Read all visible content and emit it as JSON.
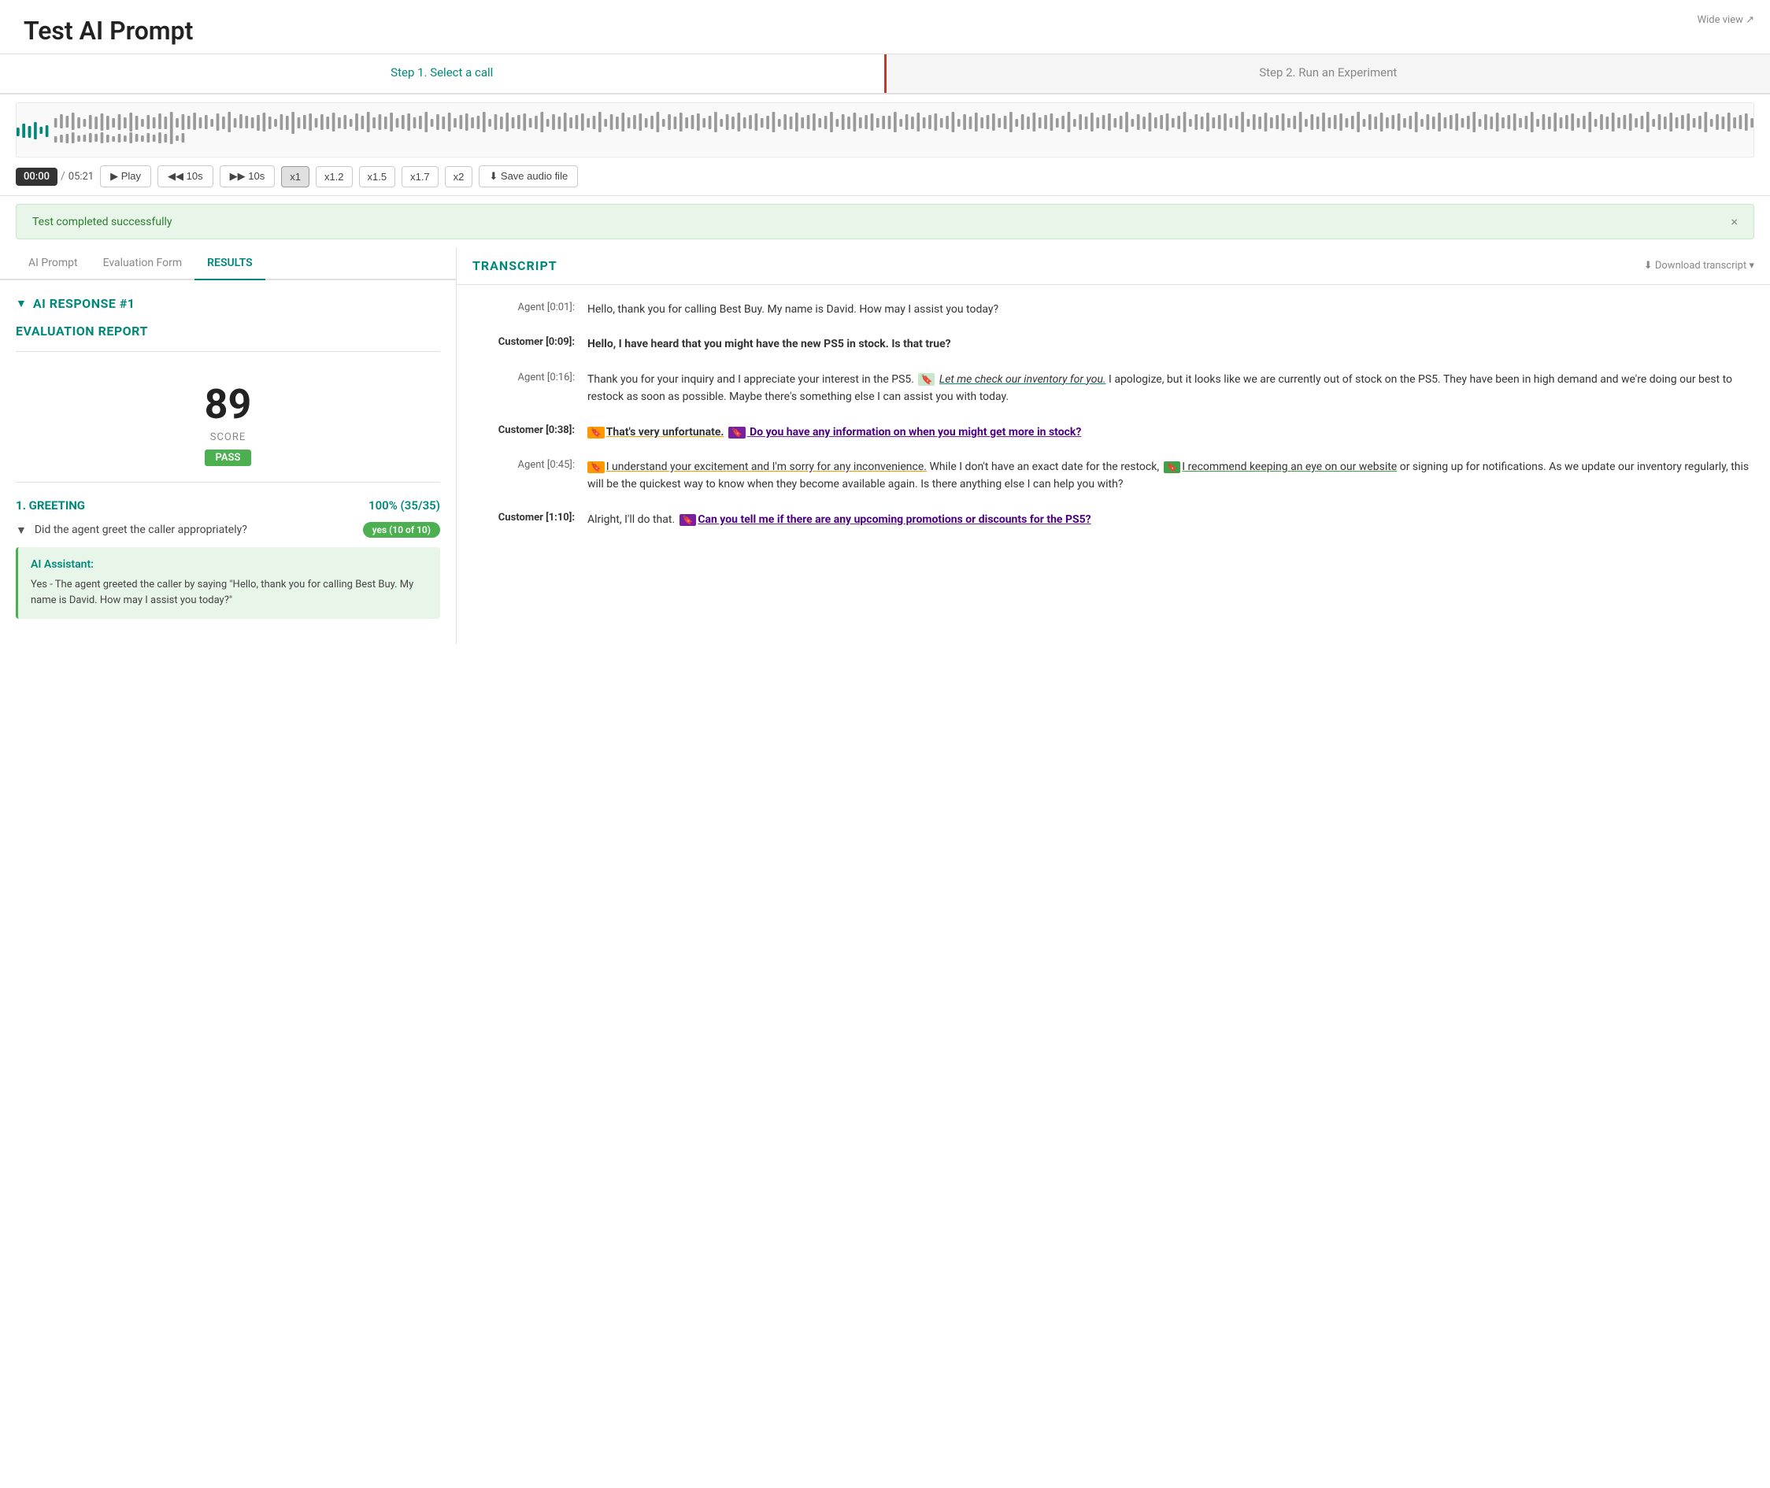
{
  "page": {
    "title": "Test AI Prompt",
    "wide_view": "Wide view ↗"
  },
  "steps": [
    {
      "id": "step1",
      "label": "Step 1. Select a call",
      "active": true
    },
    {
      "id": "step2",
      "label": "Step 2. Run an Experiment",
      "active": false
    }
  ],
  "audio": {
    "current_time": "00:00",
    "total_time": "05:21",
    "play_label": "▶ Play",
    "rewind_label": "◀◀ 10s",
    "forward_label": "▶▶ 10s",
    "speeds": [
      "x1",
      "x1.2",
      "x1.5",
      "x1.7",
      "x2"
    ],
    "active_speed": "x1",
    "save_label": "⬇ Save audio file"
  },
  "banner": {
    "text": "Test completed successfully",
    "close": "×"
  },
  "tabs": [
    {
      "id": "ai-prompt",
      "label": "AI Prompt"
    },
    {
      "id": "evaluation-form",
      "label": "Evaluation Form"
    },
    {
      "id": "results",
      "label": "RESULTS",
      "active": true
    }
  ],
  "results": {
    "ai_response_title": "AI RESPONSE #1",
    "eval_report_title": "EVALUATION REPORT",
    "score": "89",
    "score_label": "SCORE",
    "pass_label": "PASS",
    "sections": [
      {
        "id": "greeting",
        "title": "1.  GREETING",
        "score": "100% (35/35)",
        "questions": [
          {
            "text": "Did the agent greet the caller appropriately?",
            "answer": "yes (10 of 10)",
            "ai_assistant": {
              "label": "AI Assistant:",
              "text": "Yes - The agent greeted the caller by saying \"Hello, thank you for calling Best Buy. My name is David. How may I assist you today?\""
            }
          }
        ]
      }
    ]
  },
  "transcript": {
    "title": "TRANSCRIPT",
    "download_label": "⬇ Download transcript ▾",
    "entries": [
      {
        "speaker": "Agent [0:01]:",
        "is_customer": false,
        "text": "Hello, thank you for calling Best Buy. My name is David. How may I assist you today?"
      },
      {
        "speaker": "Customer [0:09]:",
        "is_customer": true,
        "text": "Hello, I have heard that you might have the new PS5 in stock. Is that true?"
      },
      {
        "speaker": "Agent [0:16]:",
        "is_customer": false,
        "text_parts": [
          {
            "type": "normal",
            "text": "Thank you for your inquiry and I appreciate your interest in the PS5. "
          },
          {
            "type": "teal-underline",
            "text": "Let me check our inventory for you."
          },
          {
            "type": "normal",
            "text": " I apologize, but it looks like we are currently out of stock on the PS5. They have been in high demand and we're doing our best to restock as soon as possible. Maybe there's something else I can assist you with today."
          }
        ]
      },
      {
        "speaker": "Customer [0:38]:",
        "is_customer": true,
        "text_parts": [
          {
            "type": "orange-icon",
            "text": "🔖"
          },
          {
            "type": "orange-underline",
            "text": "That's very unfortunate."
          },
          {
            "type": "purple-icon",
            "text": "🔖"
          },
          {
            "type": "purple-underline",
            "text": " Do you have any information on when you might get more in stock?"
          }
        ]
      },
      {
        "speaker": "Agent [0:45]:",
        "is_customer": false,
        "text_parts": [
          {
            "type": "orange-icon",
            "text": "🔖"
          },
          {
            "type": "orange-underline",
            "text": "I understand your excitement and I'm sorry for any inconvenience."
          },
          {
            "type": "normal",
            "text": " While I don't have an exact date for the restock, "
          },
          {
            "type": "green-icon",
            "text": "🔖"
          },
          {
            "type": "green-underline",
            "text": "I recommend keeping an eye on our website"
          },
          {
            "type": "normal",
            "text": " or signing up for notifications. As we update our inventory regularly, this will be the quickest way to know when they become available again. Is there anything else I can help you with?"
          }
        ]
      },
      {
        "speaker": "Customer [1:10]:",
        "is_customer": true,
        "text_parts": [
          {
            "type": "normal",
            "text": "Alright, I'll do that. "
          },
          {
            "type": "purple-icon",
            "text": "🔖"
          },
          {
            "type": "purple-underline",
            "text": "Can you tell me if there are any upcoming promotions or discounts for the PS5?"
          }
        ]
      }
    ]
  }
}
